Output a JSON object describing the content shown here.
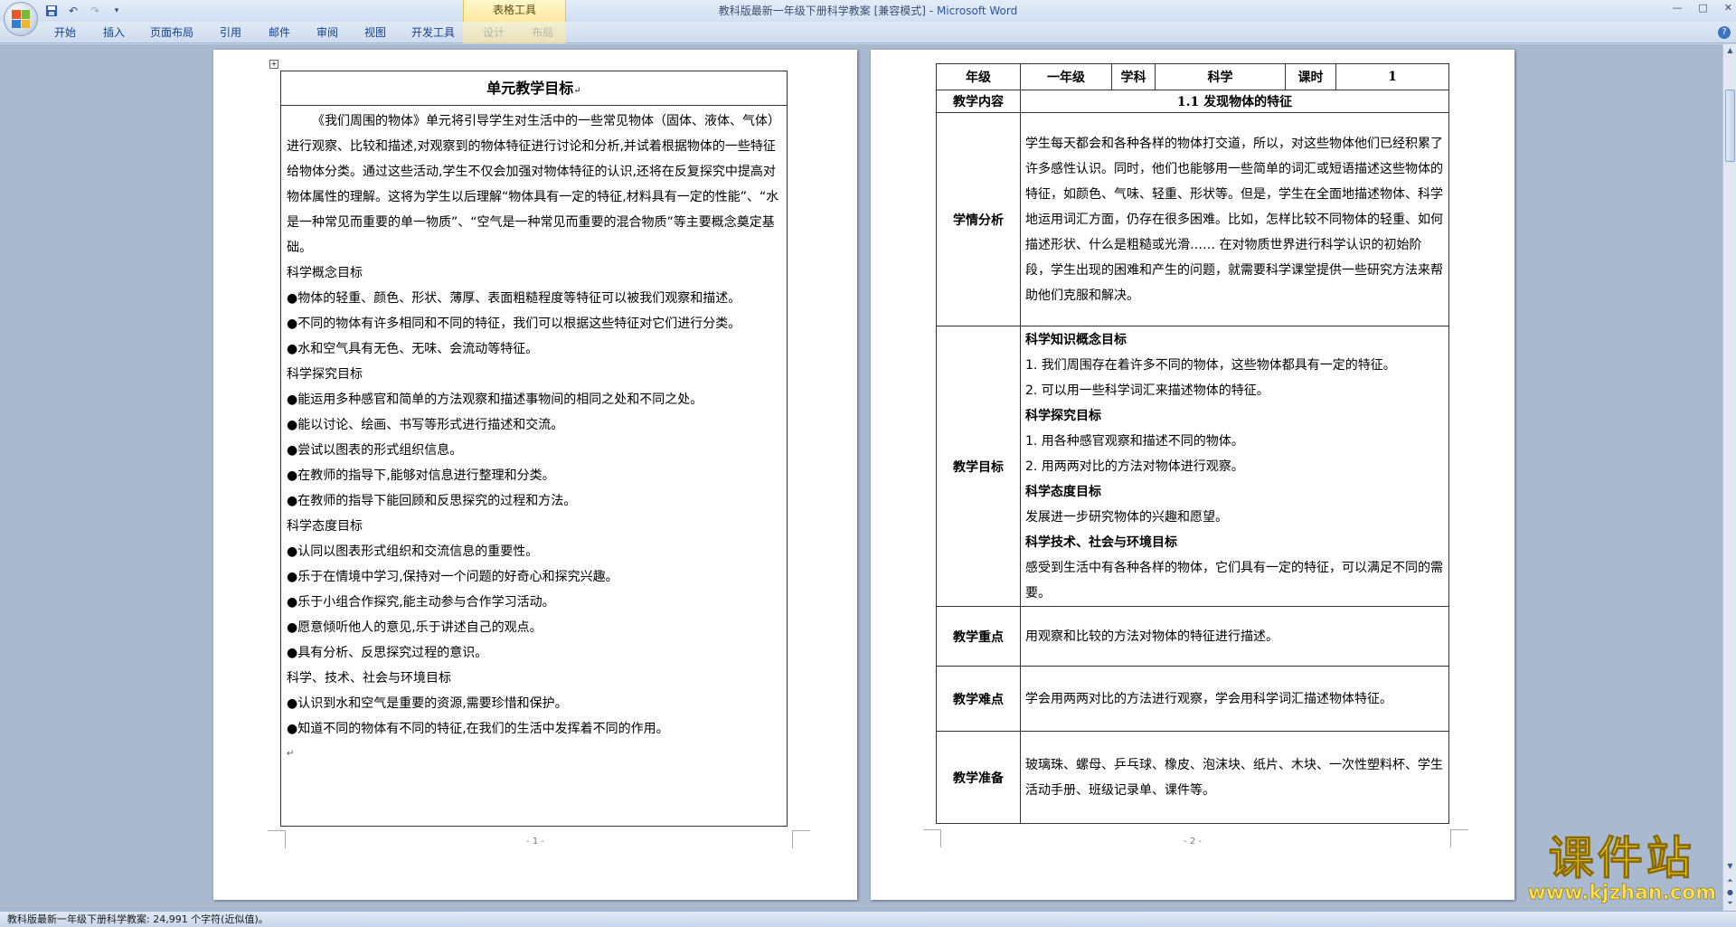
{
  "window": {
    "title_doc": "教科版最新一年级下册科学教案 [兼容模式]",
    "title_sep": " - ",
    "title_app": "Microsoft Word",
    "controls": [
      "—",
      "□",
      "✕"
    ]
  },
  "context_tab": "表格工具",
  "ribbon_tabs": [
    "开始",
    "插入",
    "页面布局",
    "引用",
    "邮件",
    "审阅",
    "视图",
    "开发工具",
    "设计",
    "布局"
  ],
  "page1": {
    "title": "单元教学目标",
    "paragraphs": [
      "《我们周围的物体》单元将引导学生对生活中的一些常见物体（固体、液体、气体）进行观察、比较和描述,对观察到的物体特征进行讨论和分析,并试着根据物体的一些特征给物体分类。通过这些活动,学生不仅会加强对物体特征的认识,还将在反复探究中提高对物体属性的理解。这将为学生以后理解“物体具有一定的特征,材料具有一定的性能”、“水是一种常见而重要的单一物质”、“空气是一种常见而重要的混合物质”等主要概念奠定基础。",
      "科学概念目标",
      "●物体的轻重、颜色、形状、薄厚、表面粗糙程度等特征可以被我们观察和描述。",
      "●不同的物体有许多相同和不同的特征，我们可以根据这些特征对它们进行分类。",
      "●水和空气具有无色、无味、会流动等特征。",
      "科学探究目标",
      "●能运用多种感官和简单的方法观察和描述事物间的相同之处和不同之处。",
      "●能以讨论、绘画、书写等形式进行描述和交流。",
      "●尝试以图表的形式组织信息。",
      "●在教师的指导下,能够对信息进行整理和分类。",
      "●在教师的指导下能回顾和反思探究的过程和方法。",
      "科学态度目标",
      "●认同以图表形式组织和交流信息的重要性。",
      "●乐于在情境中学习,保持对一个问题的好奇心和探究兴趣。",
      "●乐于小组合作探究,能主动参与合作学习活动。",
      "●愿意倾听他人的意见,乐于讲述自己的观点。",
      "●具有分析、反思探究过程的意识。",
      "科学、技术、社会与环境目标",
      "●认识到水和空气是重要的资源,需要珍惜和保护。",
      "●知道不同的物体有不同的特征,在我们的生活中发挥着不同的作用。"
    ],
    "page_number": "- 1 -"
  },
  "page2": {
    "header_row": {
      "grade_label": "年级",
      "grade_value": "一年级",
      "subject_label": "学科",
      "subject_value": "科学",
      "hours_label": "课时",
      "hours_value": "1"
    },
    "content_label": "教学内容",
    "content_value": "1.1 发现物体的特征",
    "analysis_label": "学情分析",
    "analysis_text": "学生每天都会和各种各样的物体打交道，所以，对这些物体他们已经积累了许多感性认识。同时，他们也能够用一些简单的词汇或短语描述这些物体的特征，如颜色、气味、轻重、形状等。但是，学生在全面地描述物体、科学地运用词汇方面，仍存在很多困难。比如，怎样比较不同物体的轻重、如何描述形状、什么是粗糙或光滑…… 在对物质世界进行科学认识的初始阶段，学生出现的困难和产生的问题，就需要科学课堂提供一些研究方法来帮助他们克服和解决。",
    "goals_label": "教学目标",
    "goals": [
      {
        "text": "科学知识概念目标",
        "bold": true
      },
      {
        "text": "1. 我们周围存在着许多不同的物体，这些物体都具有一定的特征。",
        "bold": false
      },
      {
        "text": "2. 可以用一些科学词汇来描述物体的特征。",
        "bold": false
      },
      {
        "text": "科学探究目标",
        "bold": true
      },
      {
        "text": "1. 用各种感官观察和描述不同的物体。",
        "bold": false
      },
      {
        "text": "2. 用两两对比的方法对物体进行观察。",
        "bold": false
      },
      {
        "text": "科学态度目标",
        "bold": true
      },
      {
        "text": "发展进一步研究物体的兴趣和愿望。",
        "bold": false
      },
      {
        "text": "科学技术、社会与环境目标",
        "bold": true
      },
      {
        "text": "感受到生活中有各种各样的物体，它们具有一定的特征，可以满足不同的需要。",
        "bold": false
      }
    ],
    "key_label": "教学重点",
    "key_text": "用观察和比较的方法对物体的特征进行描述。",
    "difficulty_label": "教学难点",
    "difficulty_text": "学会用两两对比的方法进行观察，学会用科学词汇描述物体特征。",
    "prep_label": "教学准备",
    "prep_text": "玻璃珠、螺母、乒乓球、橡皮、泡沫块、纸片、木块、一次性塑料杯、学生活动手册、班级记录单、课件等。",
    "page_number": "- 2 -"
  },
  "statusbar": {
    "text": "教科版最新一年级下册科学教案: 24,991 个字符(近似值)。"
  },
  "watermark": {
    "big": "课件站",
    "url": "www.kjzhan.com"
  },
  "colors": {
    "ribbon_text": "#15428b",
    "context_tab_bg": "#fde9a0",
    "watermark": "#f6d21a"
  }
}
